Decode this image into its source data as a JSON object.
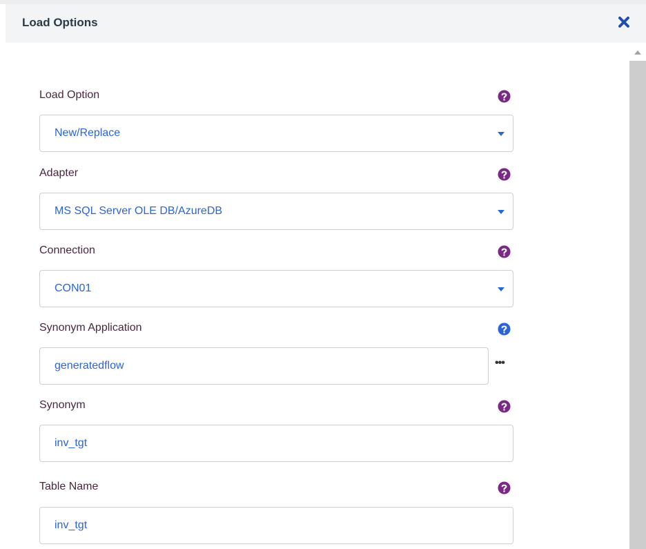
{
  "dialog": {
    "title": "Load Options",
    "close_icon": "close-icon"
  },
  "colors": {
    "help_purple": "#7a2a86",
    "help_blue": "#2b64d4",
    "value_text": "#2b64d4",
    "label_text": "#4a2540"
  },
  "fields": {
    "load_option": {
      "label": "Load Option",
      "value": "New/Replace"
    },
    "adapter": {
      "label": "Adapter",
      "value": "MS SQL Server OLE DB/AzureDB"
    },
    "connection": {
      "label": "Connection",
      "value": "CON01"
    },
    "synonym_application": {
      "label": "Synonym Application",
      "value": "generatedflow",
      "browse": "•••"
    },
    "synonym": {
      "label": "Synonym",
      "value": "inv_tgt"
    },
    "table_name": {
      "label": "Table Name",
      "value": "inv_tgt"
    }
  }
}
